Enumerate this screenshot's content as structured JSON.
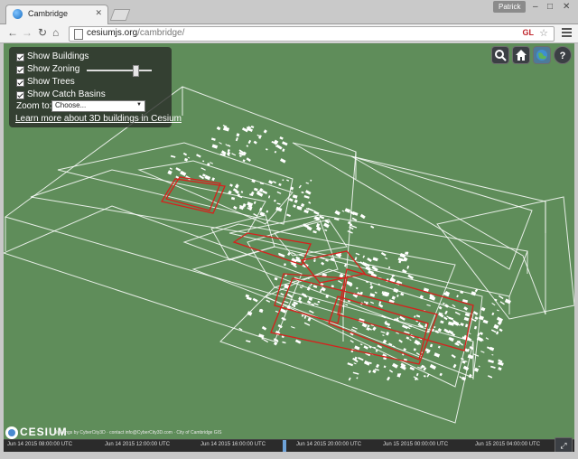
{
  "browser": {
    "tab_title": "Cambridge",
    "user": "Patrick",
    "url_domain": "cesiumjs.org",
    "url_path": "/cambridge/",
    "gl_badge": "GL"
  },
  "panel": {
    "checkboxes": [
      {
        "label": "Show Buildings",
        "checked": true
      },
      {
        "label": "Show Zoning",
        "checked": true
      },
      {
        "label": "Show Trees",
        "checked": true
      },
      {
        "label": "Show Catch Basins",
        "checked": true
      }
    ],
    "zoning_slider_value": 0.72,
    "zoom_label": "Zoom to:",
    "zoom_selected": "Choose...",
    "learn_link": "Learn more about 3D buildings in Cesium"
  },
  "toolbar_icons": [
    "search-icon",
    "home-icon",
    "scene-mode-icon",
    "help-icon"
  ],
  "footer": {
    "logo": "CESIUM",
    "credits": "Buildings by CyberCity3D · contact info@CyberCity3D.com · City of Cambridge GIS"
  },
  "timeline": {
    "labels": [
      "Jun 14 2015 08:00:00 UTC",
      "Jun 14 2015 12:00:00 UTC",
      "Jun 14 2015 16:00:00 UTC",
      "Jun 14 2015 20:00:00 UTC",
      "Jun 15 2015 00:00:00 UTC",
      "Jun 15 2015 04:00:00 UTC"
    ]
  },
  "colors": {
    "terrain": "#5f8d5a",
    "wireframe": "#ffffff",
    "zoning_highlight": "#d8201c"
  }
}
